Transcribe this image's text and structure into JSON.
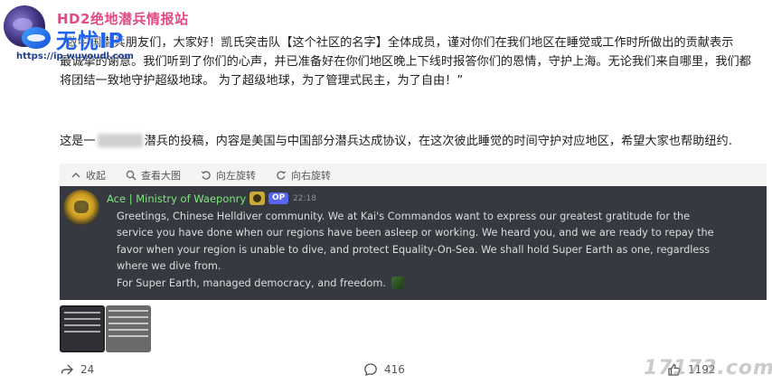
{
  "header": {
    "author": "HD2绝地潜兵情报站"
  },
  "watermark": {
    "title": "无忧IP",
    "url": "https://ip.wuyoudl.com",
    "corner": "17173.com"
  },
  "post": {
    "paragraph1": [
      "“致中国潜兵朋友们，大家好！凯氏突击队【这个社区的名字】全体成员，谨对你们在我们地区在睡觉或工作时所做出的贡献表示",
      "最诚挚的谢意。我们听到了你们的心声，并已准备好在你们地区晚上下线时报答你们的恩情，守护上海。无论我们来自哪里，我们都",
      "将团结一致地守护超级地球。 为了超级地球，为了管理式民主，为了自由！”"
    ],
    "paragraph2_pre": "这是一",
    "paragraph2_post": "潜兵的投稿，内容是美国与中国部分潜兵达成协议，在这次彼此睡觉的时间守护对应地区，希望大家也帮助纽约."
  },
  "image_toolbar": {
    "collapse": "收起",
    "view_large": "查看大图",
    "rotate_left": "向左旋转",
    "rotate_right": "向右旋转"
  },
  "discord": {
    "username": "Ace | Ministry of Waeponry",
    "op_badge": "OP",
    "time": "22:18",
    "lines": [
      "Greetings, Chinese Helldiver community. We at Kai's Commandos want to express our greatest gratitude for the",
      "service you have done when our regions have been asleep or working. We heard you, and we are ready to repay the",
      "favor when your region is unable to dive, and protect Equality-On-Sea. We shall hold Super Earth as one, regardless",
      "where we dive from.",
      "For Super Earth, managed democracy, and freedom."
    ],
    "username_color": "#7fe57f",
    "background": "#36393f"
  },
  "actions": {
    "share_count": "24",
    "comment_count": "416",
    "like_count": "1192"
  },
  "colors": {
    "author": "#e04a85",
    "watermark_title": "#1e64f0"
  }
}
